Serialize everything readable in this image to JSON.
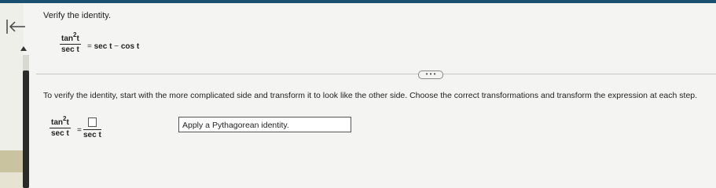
{
  "header": {
    "prompt": "Verify the identity."
  },
  "identity": {
    "numerator_base": "tan",
    "numerator_exp": "2",
    "numerator_var": "t",
    "denominator": "sec t",
    "equals": "=",
    "rhs_term1": "sec t",
    "rhs_op": "−",
    "rhs_term2": "cos t"
  },
  "more_button": {
    "label": "• • •"
  },
  "instruction": "To verify the identity, start with the more complicated side and transform it to look like the other side. Choose the correct transformations and transform the expression at each step.",
  "step": {
    "left_numerator_base": "tan",
    "left_numerator_exp": "2",
    "left_numerator_var": "t",
    "left_denominator": "sec t",
    "equals": "=",
    "right_denominator": "sec t",
    "transformation": "Apply a Pythagorean identity."
  },
  "colors": {
    "topbar": "#1b4f72",
    "side_panel": "#c9c3a0"
  }
}
